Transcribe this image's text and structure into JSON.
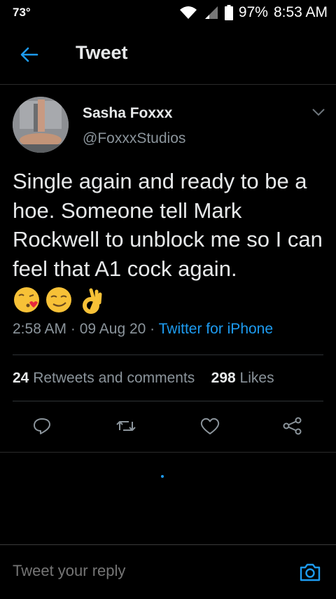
{
  "status_bar": {
    "temperature": "73°",
    "battery": "97%",
    "time": "8:53 AM"
  },
  "header": {
    "title": "Tweet",
    "back_icon": "arrow-left-icon"
  },
  "tweet": {
    "author_name": "Sasha Foxxx",
    "author_handle": "@FoxxxStudios",
    "text": "Single again and ready to be a hoe. Someone tell Mark Rockwell to unblock me so I can feel that A1 cock again.",
    "emojis": [
      "kissing-face-emoji",
      "smirking-face-emoji",
      "ok-hand-emoji"
    ],
    "time": "2:58 AM",
    "date": "09 Aug 20",
    "separator": " · ",
    "source": "Twitter for iPhone",
    "retweets_count": "24",
    "retweets_label": "Retweets and comments",
    "likes_count": "298",
    "likes_label": "Likes"
  },
  "actions": [
    "reply-icon",
    "retweet-icon",
    "like-icon",
    "share-icon"
  ],
  "reply": {
    "placeholder": "Tweet your reply",
    "camera_icon": "camera-icon"
  },
  "colors": {
    "background": "#000000",
    "text": "#e7e9ea",
    "secondary_text": "#8b949b",
    "accent": "#1d9bf0"
  }
}
